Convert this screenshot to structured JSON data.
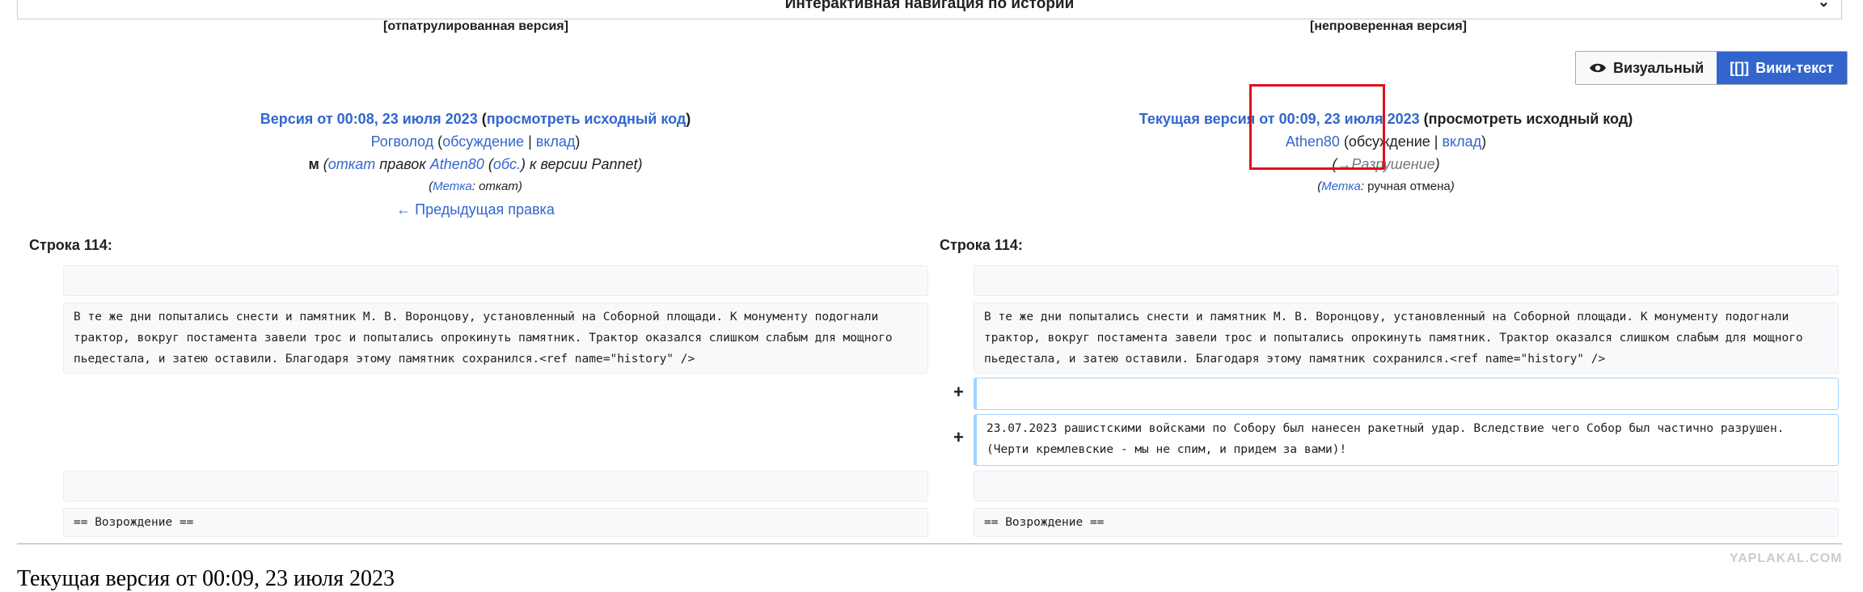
{
  "history_nav": {
    "label": "Интерактивная навигация по истории"
  },
  "left_version": {
    "status": "[отпатрулированная версия]",
    "title_prefix": "Версия от 00:08, 23 июля 2023",
    "view_source": "просмотреть исходный код",
    "user": "Рогволод",
    "talk": "обсуждение",
    "contrib": "вклад",
    "minor": "м",
    "rollback": "откат",
    "edits_of": "правок",
    "edit_user": "Athen80",
    "edit_user_talk": "обс.",
    "to_version": "к версии Pannet",
    "tag_label": "Метка",
    "tag_value": "откат",
    "prev_edit": "← Предыдущая правка"
  },
  "right_version": {
    "status": "[непроверенная версия]",
    "title_prefix": "Текущая версия от 00:09, 23 июля 2023",
    "view_source": "просмотреть исходный код",
    "user": "Athen80",
    "talk": "обсуждение",
    "contrib": "вклад",
    "summary": "→Разрушение",
    "tag_label": "Метка",
    "tag_value": "ручная отмена"
  },
  "toggle": {
    "visual": "Визуальный",
    "wiki": "Вики-текст",
    "wiki_icon": "[[]]"
  },
  "diff": {
    "left_header": "Строка 114:",
    "right_header": "Строка 114:",
    "paragraph": "В те же дни попытались снести и памятник М. В. Воронцову, установленный на Соборной площади. К монументу подогнали\nтрактор, вокруг постамента завели трос и попытались опрокинуть памятник. Трактор оказался слишком слабым для мощного\nпьедестала, и затею оставили. Благодаря этому памятник сохранился.<ref name=\"history\" />",
    "added_marker": "+",
    "added_text": "23.07.2023 рашистскими войсками по Собору был нанесен ракетный удар. Вследствие чего Собор был частично разрушен.\n(Черти кремлевские - мы не спим, и придем за вами)!",
    "section": "== Возрождение =="
  },
  "footer": {
    "title": "Текущая версия от 00:09, 23 июля 2023",
    "watermark": "YAPLAKAL.COM"
  }
}
